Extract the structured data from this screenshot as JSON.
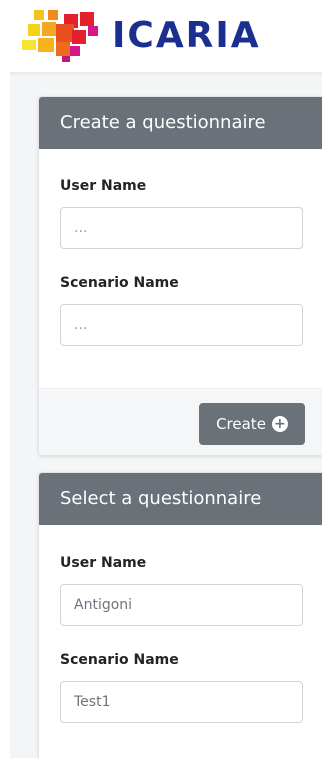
{
  "brand": {
    "name": "ICARIA",
    "color": "#1a2f8f"
  },
  "create_card": {
    "title": "Create a questionnaire",
    "user_name": {
      "label": "User Name",
      "value": "",
      "placeholder": "..."
    },
    "scenario_name": {
      "label": "Scenario Name",
      "value": "",
      "placeholder": "..."
    },
    "create_button": {
      "label": "Create",
      "icon": "plus-circle-icon"
    }
  },
  "select_card": {
    "title": "Select a questionnaire",
    "user_name": {
      "label": "User Name",
      "value": "Antigoni"
    },
    "scenario_name": {
      "label": "Scenario Name",
      "value": "Test1"
    }
  },
  "colors": {
    "card_header": "#6b7178",
    "button": "#6b7178",
    "background": "#f4f5f6"
  }
}
